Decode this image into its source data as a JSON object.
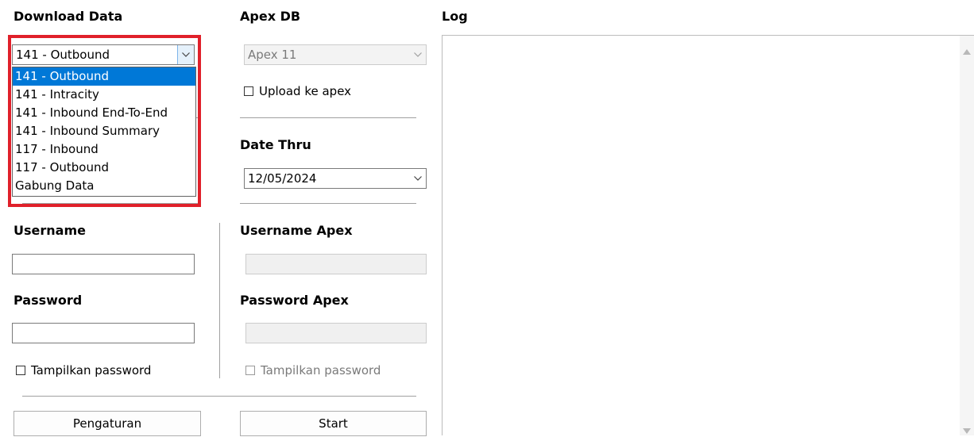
{
  "download": {
    "heading": "Download Data",
    "selected": "141 - Outbound",
    "options": [
      "141 - Outbound",
      "141 - Intracity",
      "141 - Inbound End-To-End",
      "141 - Inbound Summary",
      "117 - Inbound",
      "117 - Outbound",
      "Gabung Data"
    ],
    "selected_index": 0
  },
  "apex": {
    "heading": "Apex DB",
    "selected": "Apex 11",
    "upload_label": "Upload ke apex",
    "upload_checked": false
  },
  "date": {
    "heading": "Date Thru",
    "value": "12/05/2024"
  },
  "login": {
    "username_label": "Username",
    "username_value": "",
    "password_label": "Password",
    "password_value": "",
    "show_password_label": "Tampilkan password"
  },
  "apex_login": {
    "username_label": "Username Apex",
    "password_label": "Password Apex",
    "show_password_label": "Tampilkan password"
  },
  "buttons": {
    "settings": "Pengaturan",
    "start": "Start"
  },
  "log": {
    "heading": "Log",
    "content": ""
  },
  "colors": {
    "highlight": "#e0202a",
    "selection": "#0078d7"
  }
}
